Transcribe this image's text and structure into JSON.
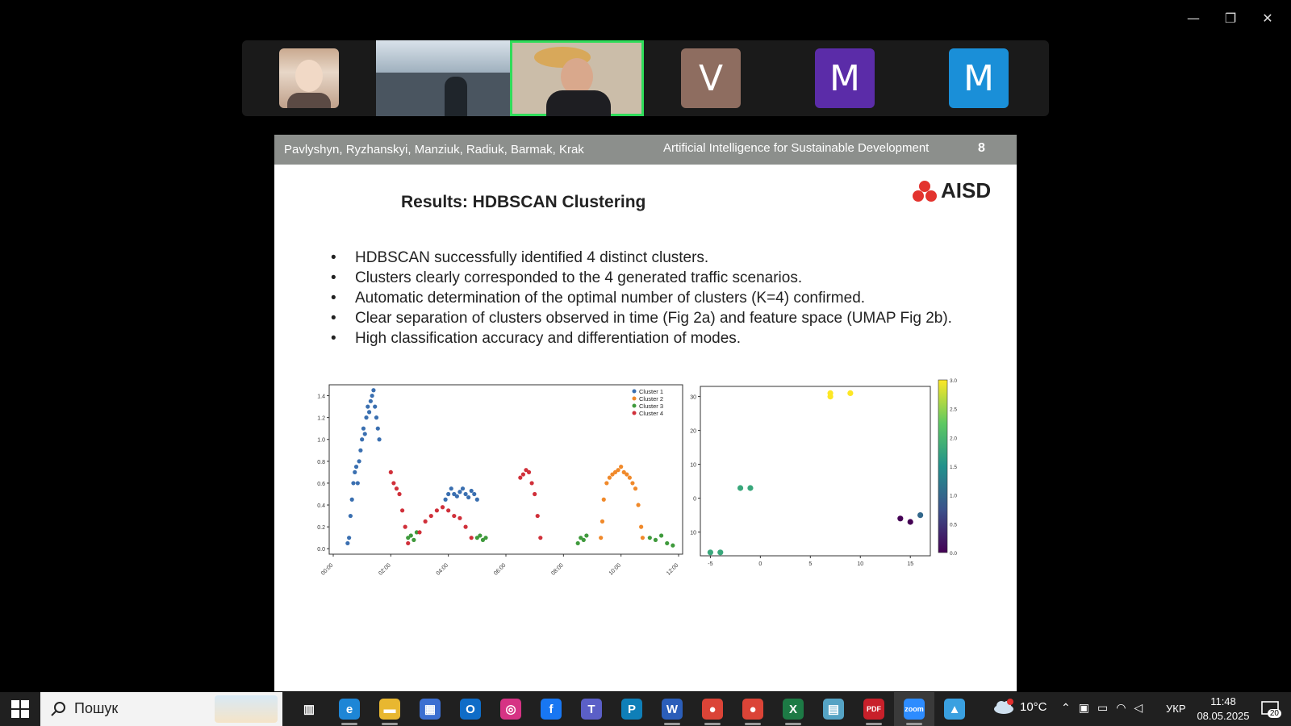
{
  "window": {
    "minimize": "—",
    "restore": "❐",
    "close": "✕"
  },
  "participants": [
    {
      "type": "photo",
      "id": "p1"
    },
    {
      "type": "video",
      "id": "p2"
    },
    {
      "type": "video",
      "id": "p3",
      "speaking": true
    },
    {
      "type": "letter",
      "letter": "V",
      "color": "#8e6d60"
    },
    {
      "type": "letter",
      "letter": "M",
      "color": "#5b2ca8"
    },
    {
      "type": "letter",
      "letter": "M",
      "color": "#1a8fd8"
    }
  ],
  "slide": {
    "authors": "Pavlyshyn, Ryzhanskyi, Manziuk, Radiuk, Barmak, Krak",
    "conference": "Artificial Intelligence for Sustainable Development",
    "page": "8",
    "logo_text": "AISD",
    "title": "Results: HDBSCAN Clustering",
    "bullets": [
      "HDBSCAN successfully identified 4 distinct clusters.",
      "Clusters clearly corresponded to the 4 generated traffic scenarios.",
      "Automatic determination of the optimal number of clusters (K=4) confirmed.",
      "Clear separation of clusters observed in time (Fig 2a) and feature space (UMAP Fig 2b).",
      "High classification accuracy and differentiation of modes."
    ]
  },
  "chart_data": [
    {
      "type": "scatter",
      "title": "",
      "xlabel": "",
      "ylabel": "",
      "x_tick_labels": [
        "00:00",
        "02:00",
        "04:00",
        "06:00",
        "08:00",
        "10:00",
        "12:00"
      ],
      "xlim": [
        0,
        12
      ],
      "ylim": [
        -0.05,
        1.5
      ],
      "y_ticks": [
        0.0,
        0.2,
        0.4,
        0.6,
        0.8,
        1.0,
        1.2,
        1.4
      ],
      "legend_position": "top-right",
      "series": [
        {
          "name": "Cluster 1",
          "color": "#3a6fb0",
          "points": [
            [
              0.5,
              0.05
            ],
            [
              0.55,
              0.1
            ],
            [
              0.6,
              0.3
            ],
            [
              0.65,
              0.45
            ],
            [
              0.7,
              0.6
            ],
            [
              0.75,
              0.7
            ],
            [
              0.8,
              0.75
            ],
            [
              0.85,
              0.6
            ],
            [
              0.9,
              0.8
            ],
            [
              0.95,
              0.9
            ],
            [
              1.0,
              1.0
            ],
            [
              1.05,
              1.1
            ],
            [
              1.1,
              1.05
            ],
            [
              1.15,
              1.2
            ],
            [
              1.2,
              1.3
            ],
            [
              1.25,
              1.25
            ],
            [
              1.3,
              1.35
            ],
            [
              1.35,
              1.4
            ],
            [
              1.4,
              1.45
            ],
            [
              1.45,
              1.3
            ],
            [
              1.5,
              1.2
            ],
            [
              1.55,
              1.1
            ],
            [
              1.6,
              1.0
            ],
            [
              3.9,
              0.45
            ],
            [
              4.0,
              0.5
            ],
            [
              4.1,
              0.55
            ],
            [
              4.2,
              0.5
            ],
            [
              4.3,
              0.48
            ],
            [
              4.4,
              0.52
            ],
            [
              4.5,
              0.55
            ],
            [
              4.6,
              0.5
            ],
            [
              4.7,
              0.47
            ],
            [
              4.8,
              0.53
            ],
            [
              4.9,
              0.5
            ],
            [
              5.0,
              0.45
            ]
          ],
          "point_size": 4
        },
        {
          "name": "Cluster 2",
          "color": "#f0892a",
          "points": [
            [
              9.3,
              0.1
            ],
            [
              9.35,
              0.25
            ],
            [
              9.4,
              0.45
            ],
            [
              9.5,
              0.6
            ],
            [
              9.6,
              0.65
            ],
            [
              9.7,
              0.68
            ],
            [
              9.8,
              0.7
            ],
            [
              9.9,
              0.72
            ],
            [
              10.0,
              0.75
            ],
            [
              10.1,
              0.7
            ],
            [
              10.2,
              0.68
            ],
            [
              10.3,
              0.65
            ],
            [
              10.4,
              0.6
            ],
            [
              10.5,
              0.55
            ],
            [
              10.6,
              0.4
            ],
            [
              10.7,
              0.2
            ],
            [
              10.75,
              0.1
            ]
          ],
          "point_size": 4
        },
        {
          "name": "Cluster 3",
          "color": "#3f9a3c",
          "points": [
            [
              2.6,
              0.1
            ],
            [
              2.7,
              0.12
            ],
            [
              2.8,
              0.08
            ],
            [
              2.9,
              0.15
            ],
            [
              5.0,
              0.1
            ],
            [
              5.1,
              0.12
            ],
            [
              5.2,
              0.08
            ],
            [
              5.3,
              0.1
            ],
            [
              8.5,
              0.05
            ],
            [
              8.6,
              0.1
            ],
            [
              8.7,
              0.08
            ],
            [
              8.8,
              0.12
            ],
            [
              11.0,
              0.1
            ],
            [
              11.2,
              0.08
            ],
            [
              11.4,
              0.12
            ],
            [
              11.6,
              0.05
            ],
            [
              11.8,
              0.03
            ]
          ],
          "point_size": 4
        },
        {
          "name": "Cluster 4",
          "color": "#d0303a",
          "points": [
            [
              2.0,
              0.7
            ],
            [
              2.1,
              0.6
            ],
            [
              2.2,
              0.55
            ],
            [
              2.3,
              0.5
            ],
            [
              2.4,
              0.35
            ],
            [
              2.5,
              0.2
            ],
            [
              2.6,
              0.05
            ],
            [
              3.0,
              0.15
            ],
            [
              3.2,
              0.25
            ],
            [
              3.4,
              0.3
            ],
            [
              3.6,
              0.35
            ],
            [
              3.8,
              0.38
            ],
            [
              4.0,
              0.35
            ],
            [
              4.2,
              0.3
            ],
            [
              4.4,
              0.28
            ],
            [
              4.6,
              0.2
            ],
            [
              4.8,
              0.1
            ],
            [
              6.5,
              0.65
            ],
            [
              6.6,
              0.68
            ],
            [
              6.7,
              0.72
            ],
            [
              6.8,
              0.7
            ],
            [
              6.9,
              0.6
            ],
            [
              7.0,
              0.5
            ],
            [
              7.1,
              0.3
            ],
            [
              7.2,
              0.1
            ]
          ],
          "point_size": 4
        }
      ]
    },
    {
      "type": "scatter",
      "title": "",
      "xlabel": "",
      "ylabel": "",
      "xlim": [
        -6,
        17
      ],
      "ylim": [
        -17,
        33
      ],
      "x_ticks": [
        -5,
        0,
        5,
        10,
        15
      ],
      "y_tick_labels": [
        "30",
        "20",
        "10",
        "0",
        "10"
      ],
      "colorbar": {
        "min": 0,
        "max": 3,
        "ticks": [
          "3.0",
          "2.5",
          "2.0",
          "1.5",
          "1.0",
          "0.5",
          "0.0"
        ],
        "colormap": "viridis"
      },
      "points": [
        {
          "x": -5,
          "y": -16,
          "v": 1.8
        },
        {
          "x": -4,
          "y": -16,
          "v": 1.8
        },
        {
          "x": -2,
          "y": 3,
          "v": 1.8
        },
        {
          "x": -1,
          "y": 3,
          "v": 1.8
        },
        {
          "x": 7,
          "y": 30,
          "v": 3.0
        },
        {
          "x": 7,
          "y": 31,
          "v": 3.0
        },
        {
          "x": 9,
          "y": 31,
          "v": 3.0
        },
        {
          "x": 14,
          "y": -6,
          "v": 0.0
        },
        {
          "x": 15,
          "y": -7,
          "v": 0.0
        },
        {
          "x": 16,
          "y": -5,
          "v": 1.0
        }
      ]
    }
  ],
  "taskbar": {
    "search_label": "Пошук",
    "apps": [
      {
        "name": "task-view",
        "glyph": "▥",
        "color": "#202020",
        "running": false
      },
      {
        "name": "edge",
        "glyph": "e",
        "color": "#1e86d6",
        "running": true
      },
      {
        "name": "file-explorer",
        "glyph": "▬",
        "color": "#e8b730",
        "running": true
      },
      {
        "name": "store",
        "glyph": "▦",
        "color": "#3c6fd1",
        "running": false
      },
      {
        "name": "outlook",
        "glyph": "O",
        "color": "#0f6cc7",
        "running": false
      },
      {
        "name": "instagram",
        "glyph": "◎",
        "color": "#d63384",
        "running": false
      },
      {
        "name": "facebook",
        "glyph": "f",
        "color": "#1877f2",
        "running": false
      },
      {
        "name": "teams",
        "glyph": "T",
        "color": "#5b5fc7",
        "running": false
      },
      {
        "name": "pearson",
        "glyph": "P",
        "color": "#0f7fb8",
        "running": false
      },
      {
        "name": "word",
        "glyph": "W",
        "color": "#2b5eb9",
        "running": true
      },
      {
        "name": "chrome",
        "glyph": "●",
        "color": "#db4437",
        "running": true
      },
      {
        "name": "chrome-2",
        "glyph": "●",
        "color": "#db4437",
        "running": true
      },
      {
        "name": "excel",
        "glyph": "X",
        "color": "#1d7a45",
        "running": true
      },
      {
        "name": "notes",
        "glyph": "▤",
        "color": "#55a3c4",
        "running": false
      },
      {
        "name": "pdf-editor",
        "glyph": "PDF",
        "color": "#c8202a",
        "running": true
      },
      {
        "name": "zoom",
        "glyph": "zoom",
        "color": "#2d8cff",
        "running": true,
        "active": true
      },
      {
        "name": "photos",
        "glyph": "▲",
        "color": "#3aa0e0",
        "running": false
      }
    ],
    "weather": {
      "temp": "10°C"
    },
    "language": "УКР",
    "time": "11:48",
    "date": "08.05.2025",
    "notifications": "20"
  }
}
